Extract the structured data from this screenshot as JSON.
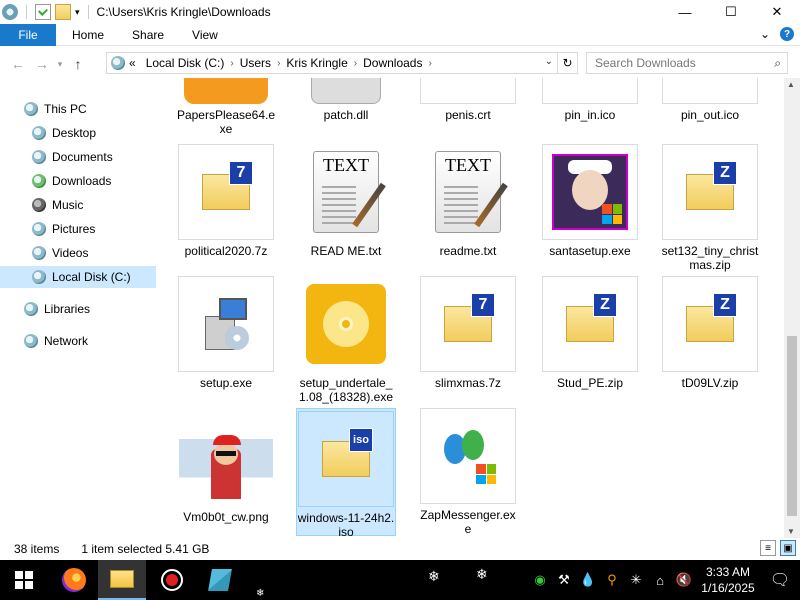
{
  "window": {
    "title": "C:\\Users\\Kris Kringle\\Downloads",
    "minimize": "—",
    "maximize": "☐",
    "close": "✕"
  },
  "ribbon": {
    "file": "File",
    "tabs": [
      "Home",
      "Share",
      "View"
    ],
    "expand": "⌄",
    "help": "?"
  },
  "address": {
    "overflow": "«",
    "segments": [
      "Local Disk (C:)",
      "Users",
      "Kris Kringle",
      "Downloads"
    ],
    "search_placeholder": "Search Downloads"
  },
  "nav": {
    "items": [
      {
        "label": "This PC"
      },
      {
        "label": "Desktop"
      },
      {
        "label": "Documents"
      },
      {
        "label": "Downloads"
      },
      {
        "label": "Music"
      },
      {
        "label": "Pictures"
      },
      {
        "label": "Videos"
      },
      {
        "label": "Local Disk (C:)"
      },
      {
        "label": "Libraries"
      },
      {
        "label": "Network"
      }
    ]
  },
  "files": [
    {
      "name": "PapersPlease64.exe",
      "icon": "app-icon"
    },
    {
      "name": "patch.dll",
      "icon": "dll-icon"
    },
    {
      "name": "penis.crt",
      "icon": "certificate-icon"
    },
    {
      "name": "pin_in.ico",
      "icon": "icon-file-icon"
    },
    {
      "name": "pin_out.ico",
      "icon": "icon-file-icon"
    },
    {
      "name": "political2020.7z",
      "icon": "7z-archive-icon",
      "badge": "7"
    },
    {
      "name": "READ ME.txt",
      "icon": "text-file-icon",
      "thumb_text": "TEXT"
    },
    {
      "name": "readme.txt",
      "icon": "text-file-icon",
      "thumb_text": "TEXT"
    },
    {
      "name": "santasetup.exe",
      "icon": "santa-app-icon"
    },
    {
      "name": "set132_tiny_christmas.zip",
      "icon": "zip-archive-icon",
      "badge": "Z"
    },
    {
      "name": "setup.exe",
      "icon": "installer-icon"
    },
    {
      "name": "setup_undertale_1.08_(18328).exe",
      "icon": "disc-installer-icon"
    },
    {
      "name": "slimxmas.7z",
      "icon": "7z-archive-icon",
      "badge": "7"
    },
    {
      "name": "Stud_PE.zip",
      "icon": "zip-archive-icon",
      "badge": "Z"
    },
    {
      "name": "tD09LV.zip",
      "icon": "zip-archive-icon",
      "badge": "Z"
    },
    {
      "name": "Vm0b0t_cw.png",
      "icon": "image-thumbnail"
    },
    {
      "name": "windows-11-24h2.iso",
      "icon": "iso-disc-icon",
      "badge": "iso",
      "selected": true
    },
    {
      "name": "ZapMessenger.exe",
      "icon": "messenger-icon"
    }
  ],
  "status": {
    "count": "38 items",
    "selection": "1 item selected  5.41 GB"
  },
  "taskbar": {
    "time": "3:33 AM",
    "date": "1/16/2025"
  },
  "colors": {
    "accent": "#1979ca",
    "selection": "#cce8ff",
    "taskbar": "#000000"
  }
}
